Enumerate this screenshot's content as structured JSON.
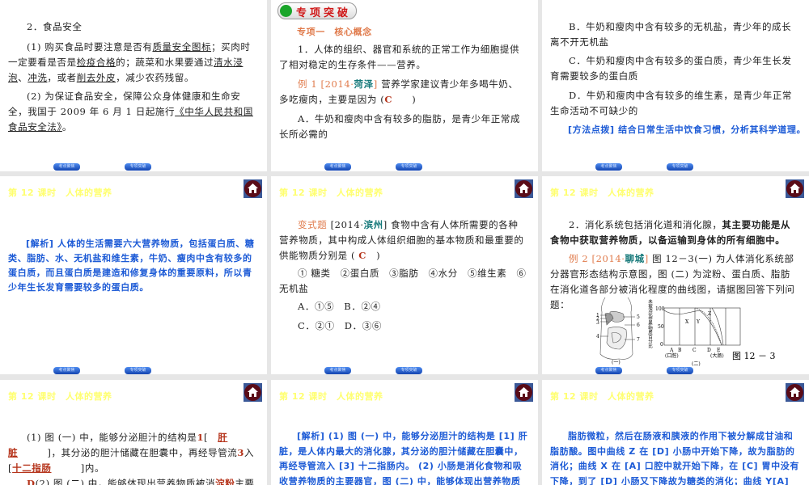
{
  "lesson_header": "第 12 课时　人体的营养",
  "nav": {
    "prev": "考点聚焦",
    "next": "专项突破"
  },
  "s1": {
    "title": "2．食品安全",
    "p1": [
      {
        "t": "(1) 购买食品时要注意是否有"
      },
      {
        "t": "质量安全图标",
        "u": 1
      },
      {
        "t": "；买肉时一定要看是否是"
      },
      {
        "t": "检疫合格",
        "u": 1
      },
      {
        "t": "的；蔬菜和水果要通过"
      },
      {
        "t": "清水浸泡",
        "u": 1
      },
      {
        "t": "、"
      },
      {
        "t": "冲洗",
        "u": 1
      },
      {
        "t": "，或者"
      },
      {
        "t": "削去外皮",
        "u": 1
      },
      {
        "t": "，减少农药残留。"
      }
    ],
    "p2": [
      {
        "t": "(2) 为保证食品安全，保障公众身体健康和生命安全，我国于 2009 年 6 月 1 日起施行"
      },
      {
        "t": "《中华人民共和国食品安全法》",
        "u": 1
      },
      {
        "t": "。"
      }
    ]
  },
  "s2": {
    "badge": "专项突破",
    "section": "专项一　核心概念",
    "p1": "1．人体的组织、器官和系统的正常工作为细胞提供了相对稳定的生存条件——营养。",
    "ex": [
      {
        "t": "例 1 [2014·",
        "c": "or"
      },
      {
        "t": "菏泽",
        "c": "teal"
      },
      {
        "t": "]",
        "c": "or"
      },
      {
        "t": " 营养学家建议青少年多喝牛奶、多吃瘦肉，主要是因为 ("
      },
      {
        "t": "C",
        "c": "red"
      },
      {
        "t": "　　)"
      }
    ],
    "optA": "A．牛奶和瘦肉中含有较多的脂肪，是青少年正常成长所必需的"
  },
  "s3": {
    "optB": "B．牛奶和瘦肉中含有较多的无机盐，青少年的成长离不开无机盐",
    "optC": "C．牛奶和瘦肉中含有较多的蛋白质，青少年生长发育需要较多的蛋白质",
    "optD": "D．牛奶和瘦肉中含有较多的维生素，是青少年正常生命活动不可缺少的",
    "tip": "[方法点拨] 结合日常生活中饮食习惯，分析其科学道理。"
  },
  "s4": {
    "analysis": "[解析] 人体的生活需要六大营养物质，包括蛋白质、糖类、脂肪、水、无机盐和维生素，牛奶、瘦肉中含有较多的蛋白质，而且蛋白质是建造和修复身体的重要原料，所以青少年生长发育需要较多的蛋白质。"
  },
  "s5": {
    "q": [
      {
        "t": "变式题",
        "c": "or"
      },
      {
        "t": " [2014·"
      },
      {
        "t": "滨州",
        "c": "teal"
      },
      {
        "t": "] 食物中含有人体所需要的各种营养物质，其中构成人体组织细胞的基本物质和最重要的供能物质分别是 ( "
      },
      {
        "t": "C",
        "c": "red"
      },
      {
        "t": "　)"
      }
    ],
    "items": "① 糖类　②蛋白质　③脂肪　④水分　⑤维生素　⑥无机盐",
    "optAB": "A．①⑤　B．②④",
    "optCD": "C．②①　D．③⑥"
  },
  "s6": {
    "p1": [
      {
        "t": "2．消化系统包括消化道和消化腺，"
      },
      {
        "t": "其主要功能是从食物中获取营养物质，以备运输到身体的所有细胞中。",
        "b": 1
      }
    ],
    "ex": [
      {
        "t": "例 2 [2014·",
        "c": "or"
      },
      {
        "t": "聊城",
        "c": "teal"
      },
      {
        "t": "]",
        "c": "or"
      },
      {
        "t": " 图 12－3(一) 为人体消化系统部分器官形态结构示意图，图 (二) 为淀粉、蛋白质、脂肪在消化道各部分被消化程度的曲线图，请据图回答下列问题："
      }
    ],
    "fig1_labels": [
      "1",
      "2",
      "3",
      "4",
      "5",
      "6",
      "7"
    ],
    "fig1_caption": "(一)",
    "fig2_ylabel": "未被消化营养物质百分比",
    "fig2_yticks": [
      "100",
      "50",
      "0"
    ],
    "fig2_xlabels": [
      "A",
      "B",
      "C",
      "D",
      "E"
    ],
    "fig2_xnotes": [
      "(口腔)",
      "(大肠)"
    ],
    "fig2_curves": [
      "X",
      "Y",
      "Z"
    ],
    "fig2_caption": "(二)",
    "figure_title": "图 12 － 3"
  },
  "s7": {
    "p1": [
      {
        "t": "(1) 图 (一) 中，能够分泌胆汁的结构是"
      },
      {
        "t": "1",
        "c": "red"
      },
      {
        "t": "[　"
      },
      {
        "t": "肝脏",
        "c": "red",
        "u": 1
      },
      {
        "t": "　　　]，其分泌的胆汁储藏在胆囊中，再经导管流"
      },
      {
        "t": "3",
        "c": "red"
      },
      {
        "t": "入 ["
      },
      {
        "t": "十二指肠",
        "c": "red",
        "u": 1
      },
      {
        "t": "　　　]内。"
      }
    ],
    "p2": [
      {
        "t": "D",
        "c": "red"
      },
      {
        "t": "(2) 图 (二) 中，能够体现出营养物质被消"
      },
      {
        "t": "淀粉",
        "c": "red"
      },
      {
        "t": "主要部位是"
      }
    ]
  },
  "s8": {
    "analysis": "[解析] (1) 图 (一) 中，能够分泌胆汁的结构是 [1] 肝脏，是人体内最大的消化腺，其分泌的胆汁储藏在胆囊中，再经导管流入 [3] 十二指肠内。 (2) 小肠是消化食物和吸收营养物质的主要器官，图 (二) 中，能够体现出营养物质被消化的主"
  },
  "s9": {
    "analysis": "脂肪微粒，然后在肠液和胰液的作用下被分解成甘油和脂肪酸。图中曲线 Z 在 [D] 小肠中开始下降，故为脂肪的消化；曲线 X 在 [A] 口腔中就开始下降，在 [C] 胃中没有下降，到了 [D] 小肠又下降故为糖类的消化；曲线 Y[A] 口腔没有下降到了"
  }
}
